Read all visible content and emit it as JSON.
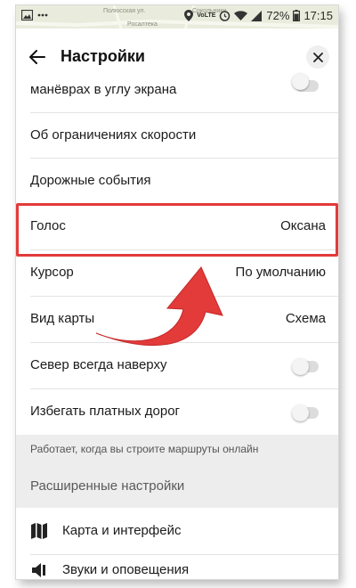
{
  "status_bar": {
    "map_labels": [
      "Полюсская ул.",
      "Сокольники",
      "Росалтека"
    ],
    "battery": "72%",
    "time": "17:15",
    "network": "VoLTE",
    "icons": [
      "image-icon",
      "dots-icon",
      "location-icon",
      "volte-icon",
      "alarm-icon",
      "wifi-icon",
      "signal-icon",
      "battery-icon"
    ]
  },
  "header": {
    "title": "Настройки",
    "back_icon": "arrow-left-icon",
    "close_icon": "close-icon"
  },
  "settings": {
    "rows": [
      {
        "label": "манёврах в углу экрана",
        "type": "toggle",
        "on": false
      },
      {
        "label": "Об ограничениях скорости",
        "type": "link"
      },
      {
        "label": "Дорожные события",
        "type": "link"
      },
      {
        "label": "Голос",
        "type": "value",
        "value": "Оксана"
      },
      {
        "label": "Курсор",
        "type": "value",
        "value": "По умолчанию"
      },
      {
        "label": "Вид карты",
        "type": "value",
        "value": "Схема"
      },
      {
        "label": "Север всегда наверху",
        "type": "toggle",
        "on": false
      },
      {
        "label": "Избегать платных дорог",
        "type": "toggle",
        "on": false
      }
    ],
    "note": "Работает, когда вы строите маршруты онлайн",
    "section_title": "Расширенные настройки",
    "advanced": [
      {
        "label": "Карта и интерфейс",
        "icon": "map-icon"
      },
      {
        "label": "Звуки и оповещения",
        "icon": "speaker-icon"
      }
    ]
  },
  "annotation": {
    "highlight_color": "#e33a3a",
    "arrow_color": "#e33a3a"
  }
}
